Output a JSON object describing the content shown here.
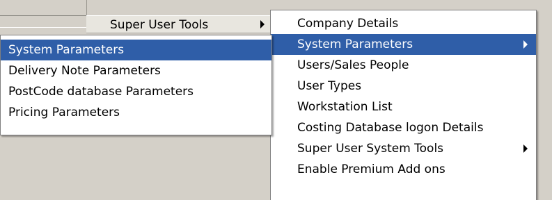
{
  "parent_menu": {
    "item_label": "Super User Tools",
    "item_arrow_icon": "submenu-arrow-icon"
  },
  "submenu": {
    "items": [
      {
        "label": "Company Details",
        "has_submenu": false
      },
      {
        "label": "System Parameters",
        "has_submenu": true,
        "highlighted": true
      },
      {
        "label": "Users/Sales People",
        "has_submenu": false
      },
      {
        "label": "User Types",
        "has_submenu": false
      },
      {
        "label": "Workstation List",
        "has_submenu": false
      },
      {
        "label": "Costing Database logon Details",
        "has_submenu": false
      },
      {
        "label": "Super User System Tools",
        "has_submenu": true
      },
      {
        "label": "Enable Premium Add ons",
        "has_submenu": false
      }
    ]
  },
  "flyout": {
    "items": [
      {
        "label": "System Parameters",
        "highlighted": true
      },
      {
        "label": "Delivery Note Parameters"
      },
      {
        "label": "PostCode database Parameters"
      },
      {
        "label": "Pricing Parameters"
      }
    ]
  },
  "colors": {
    "highlight": "#2f5ea8",
    "menu_background": "#ffffff",
    "window_background": "#d4d0c8"
  }
}
